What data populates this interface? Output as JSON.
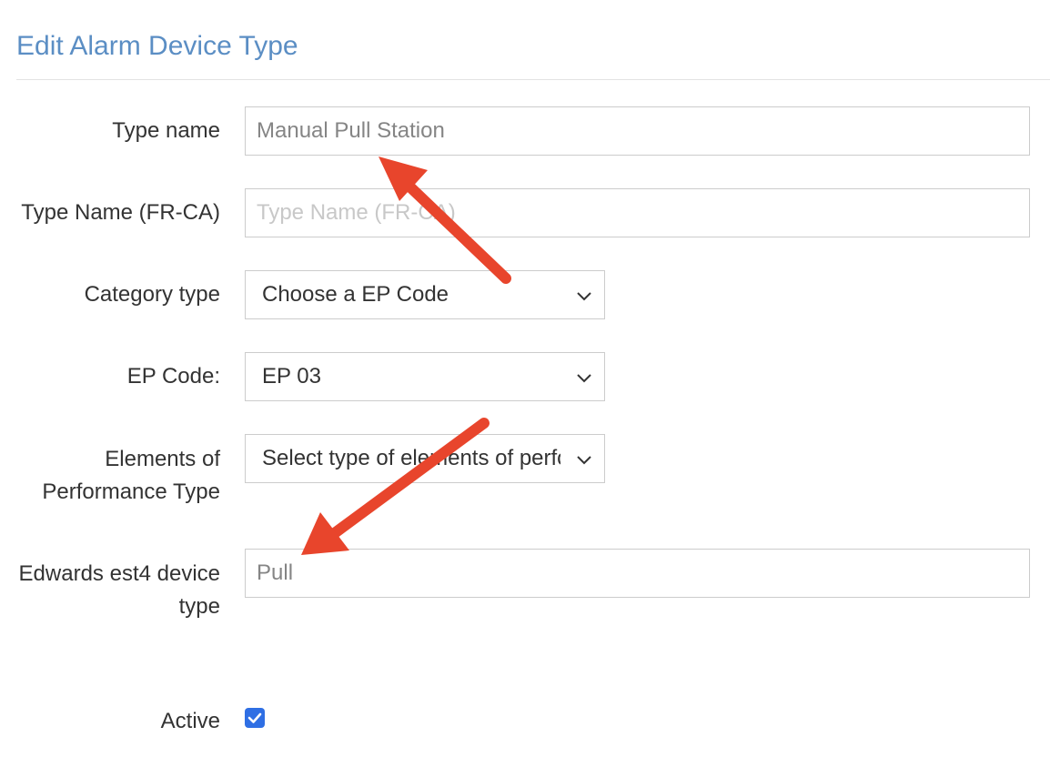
{
  "page": {
    "title": "Edit Alarm Device Type"
  },
  "form": {
    "type_name": {
      "label": "Type name",
      "value": "Manual Pull Station"
    },
    "type_name_fr": {
      "label": "Type Name (FR-CA)",
      "value": "",
      "placeholder": "Type Name (FR-CA)"
    },
    "category_type": {
      "label": "Category type",
      "selected": "Choose a EP Code"
    },
    "ep_code": {
      "label": "EP Code:",
      "selected": "EP 03"
    },
    "elements_performance": {
      "label": "Elements of Performance Type",
      "selected": "Select type of elements of performance"
    },
    "edwards_type": {
      "label": "Edwards est4 device type",
      "value": "Pull"
    },
    "active": {
      "label": "Active",
      "checked": true
    }
  },
  "colors": {
    "title": "#5b8ec4",
    "annotation_arrow": "#e8452c",
    "checkbox": "#2f6fe4"
  },
  "icons": {
    "select_arrow": "chevron-down-icon",
    "check": "checkmark-icon",
    "annotation": "arrow-icon"
  }
}
